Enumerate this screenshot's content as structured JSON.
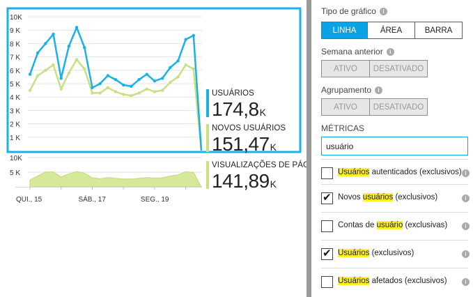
{
  "chart_data": [
    {
      "type": "line",
      "y_ticks": [
        "10K",
        "9 K",
        "8 K",
        "7 K",
        "6 K",
        "5 K",
        "4 K",
        "3 K",
        "2 K",
        "1 K"
      ],
      "ylim": [
        0,
        10000
      ],
      "x_labels": [
        "QUI., 15",
        "SÁB., 17",
        "SEG., 19"
      ],
      "series": [
        {
          "name": "USUÁRIOS",
          "color": "#1ab1e8",
          "values": [
            5700,
            7300,
            8000,
            8700,
            5400,
            7800,
            9200,
            7700,
            4700,
            5000,
            5600,
            5300,
            4900,
            4800,
            5300,
            5700,
            5200,
            5400,
            6200,
            6700,
            8300,
            8600,
            0
          ]
        },
        {
          "name": "NOVOS USUÁRIOS",
          "color": "#c8e082",
          "values": [
            4500,
            5600,
            6000,
            6400,
            4600,
            5800,
            6800,
            6100,
            4300,
            4300,
            4700,
            4400,
            4200,
            4100,
            4300,
            4600,
            4400,
            4500,
            5100,
            5500,
            6400,
            6100,
            0
          ]
        }
      ]
    },
    {
      "type": "area",
      "y_ticks": [
        "10K",
        "5 K"
      ],
      "ylim": [
        0,
        10000
      ],
      "series": [
        {
          "name": "VISUALIZAÇÕES DE PÁG...",
          "color": "#d6e89a",
          "values": [
            2400,
            3700,
            5100,
            5100,
            3400,
            4400,
            5200,
            4700,
            3100,
            2800,
            3200,
            2900,
            2700,
            2700,
            2900,
            3200,
            3000,
            3100,
            3700,
            4100,
            5200,
            4900,
            0
          ]
        }
      ]
    }
  ],
  "legend": {
    "users": {
      "name": "USUÁRIOS",
      "value": "174,8",
      "unit": "K",
      "color": "#1ab1e8"
    },
    "new_users": {
      "name": "NOVOS USUÁRIOS",
      "value": "151,47",
      "unit": "K",
      "color": "#c8e082"
    },
    "page_views": {
      "name": "VISUALIZAÇÕES DE PÁG...",
      "value": "141,89",
      "unit": "K",
      "color": "#c8e082"
    }
  },
  "panel": {
    "chart_type": {
      "label": "Tipo de gráfico",
      "options": [
        "LINHA",
        "ÁREA",
        "BARRA"
      ],
      "selected": "LINHA"
    },
    "previous_week": {
      "label": "Semana anterior",
      "options": [
        "ATIVO",
        "DESATIVADO"
      ]
    },
    "grouping": {
      "label": "Agrupamento",
      "options": [
        "ATIVO",
        "DESATIVADO"
      ]
    },
    "metrics": {
      "label": "MÉTRICAS",
      "search_value": "usuário",
      "items": [
        {
          "checked": false,
          "parts": [
            [
              "Usuários",
              true
            ],
            [
              " autenticados (exclusivos)",
              false
            ]
          ]
        },
        {
          "checked": true,
          "parts": [
            [
              "Novos ",
              false
            ],
            [
              "usuários",
              true
            ],
            [
              " (exclusivos)",
              false
            ]
          ]
        },
        {
          "checked": false,
          "parts": [
            [
              "Contas de ",
              false
            ],
            [
              "usuário",
              true
            ],
            [
              " (exclusivas)",
              false
            ]
          ]
        },
        {
          "checked": true,
          "parts": [
            [
              "Usuários",
              true
            ],
            [
              " (exclusivos)",
              false
            ]
          ]
        },
        {
          "checked": false,
          "parts": [
            [
              "Usuários",
              true
            ],
            [
              " afetados (exclusivos)",
              false
            ]
          ]
        }
      ]
    }
  },
  "colors": {
    "accent": "#0aa3e6",
    "selection_border": "#1ab1e8",
    "highlight": "#ffef2a",
    "splitter": "#9a9a9a"
  }
}
